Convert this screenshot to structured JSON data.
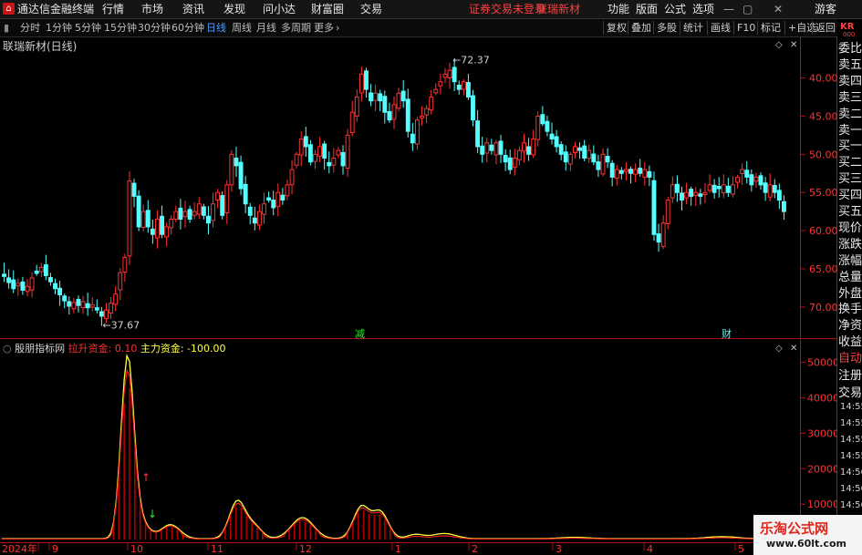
{
  "titlebar": {
    "app_name": "通达信金融终端",
    "menu": [
      "行情",
      "市场",
      "资讯",
      "发现",
      "问小达",
      "财富圈",
      "交易"
    ],
    "status_login": "证券交易未登录",
    "status_stock": "联瑞新材",
    "right_menu": [
      "功能",
      "版面",
      "公式",
      "选项"
    ],
    "guest": "游客"
  },
  "toolbar": {
    "periods": [
      "分时",
      "1分钟",
      "5分钟",
      "15分钟",
      "30分钟",
      "60分钟",
      "日线",
      "周线",
      "月线",
      "多周期",
      "更多"
    ],
    "active_period": "日线",
    "right_buttons": [
      "复权",
      "叠加",
      "多股",
      "统计",
      "画线",
      "F10",
      "标记",
      "+自选",
      "返回"
    ]
  },
  "main_chart": {
    "title": "联瑞新材(日线)",
    "y_ticks": [
      "70.00",
      "65.00",
      "60.00",
      "55.00",
      "50.00",
      "45.00",
      "40.00"
    ],
    "high_label": "72.37",
    "low_label": "37.67",
    "marker_jian": "减",
    "marker_cai": "财"
  },
  "indicator_panel": {
    "name": "殷朋指标网",
    "label1": "拉升资金:",
    "value1": "0.10",
    "label2": "主力资金:",
    "value2": "-100.00",
    "y_ticks": [
      "50000",
      "40000",
      "30000",
      "20000",
      "10000"
    ],
    "x_labels": [
      "2024年",
      "9",
      "10",
      "11",
      "12",
      "1",
      "2",
      "3",
      "4",
      "5"
    ]
  },
  "sidebar": {
    "items": [
      "委比",
      "卖五",
      "卖四",
      "卖三",
      "卖二",
      "卖一",
      "买一",
      "买二",
      "买三",
      "买四",
      "买五",
      "现价",
      "涨跌",
      "涨幅",
      "总量",
      "外盘",
      "换手",
      "净资",
      "收益"
    ],
    "code_prefix": "KR",
    "code_sub": "000",
    "auto": "自动",
    "register": "注册",
    "trade": "交易",
    "times": [
      "14:55",
      "14:55",
      "14:55",
      "14:55",
      "14:56",
      "14:56",
      "14:56",
      "14:56"
    ]
  },
  "watermark": {
    "name": "乐淘公式网",
    "url": "www.60lt.com"
  },
  "colors": {
    "up": "#ff3232",
    "down": "#54ffff",
    "axis": "#b01010",
    "active": "#4f9cff",
    "yellow_line": "#ffff40"
  },
  "chart_data": [
    {
      "type": "candlestick",
      "title": "联瑞新材(日线)",
      "ylim": [
        37,
        74
      ],
      "y_ticks": [
        40,
        45,
        50,
        55,
        60,
        65,
        70
      ],
      "annotations": [
        {
          "label": "72.37",
          "value": 72.37
        },
        {
          "label": "37.67",
          "value": 37.67
        }
      ],
      "closes": [
        44,
        43.2,
        42.4,
        43.1,
        42.2,
        42.7,
        43.8,
        44.4,
        45.2,
        44.1,
        43.3,
        42.4,
        41.6,
        40.8,
        40.1,
        40.6,
        40.2,
        40.7,
        39.9,
        40.3,
        39.6,
        38.8,
        39.6,
        40.5,
        41.7,
        44.5,
        46.5,
        56.5,
        54.5,
        50.5,
        52.5,
        50.5,
        49.5,
        51.5,
        49.5,
        50.5,
        51.5,
        52.5,
        51.5,
        52.5,
        51.5,
        52.5,
        53.5,
        52.0,
        51.0,
        53.5,
        55.0,
        52.0,
        56.0,
        60.0,
        58.5,
        55.5,
        53.5,
        52.0,
        51.0,
        52.5,
        53.5,
        54.0,
        53.0,
        55.0,
        54.0,
        56.0,
        58.0,
        60.0,
        62.0,
        61.0,
        59.0,
        60.0,
        61.0,
        59.5,
        58.5,
        59.5,
        60.5,
        58.5,
        62.5,
        65.5,
        67.5,
        70.5,
        68.5,
        67.0,
        68.0,
        67.0,
        65.5,
        64.5,
        66.5,
        68.0,
        67.0,
        63.0,
        61.5,
        64.5,
        65.0,
        66.0,
        67.5,
        68.5,
        69.5,
        70.5,
        71.0,
        69.5,
        68.5,
        69.5,
        67.5,
        64.5,
        61.0,
        60.0,
        61.5,
        60.5,
        61.5,
        60.0,
        59.0,
        58.0,
        59.5,
        60.5,
        61.5,
        60.0,
        62.0,
        65.0,
        64.0,
        63.0,
        62.0,
        61.0,
        60.0,
        59.0,
        60.0,
        61.0,
        60.5,
        59.5,
        60.5,
        59.0,
        58.0,
        60.0,
        59.0,
        57.0,
        58.0,
        57.5,
        58.0,
        57.5,
        58.0,
        57.5,
        58.0,
        57.0,
        49.5,
        48.5,
        51.0,
        54.0,
        56.0,
        55.0,
        54.0,
        55.0,
        54.5,
        55.0,
        54.5,
        55.0,
        56.0,
        55.0,
        55.5,
        56.0,
        55.0,
        56.0,
        57.0,
        58.0,
        57.0,
        56.0,
        57.0,
        56.0,
        55.0,
        56.0,
        55.0,
        54.0,
        52.5
      ]
    },
    {
      "type": "line",
      "name": "主力资金",
      "x_labels": [
        "2024年",
        "9",
        "10",
        "11",
        "12",
        "1",
        "2",
        "3",
        "4",
        "5"
      ],
      "ylim": [
        0,
        53000
      ],
      "y_ticks": [
        10000,
        20000,
        30000,
        40000,
        50000
      ],
      "peaks": [
        {
          "x_label": "10",
          "value": 51000
        },
        {
          "x_label": "11",
          "value": 10500
        },
        {
          "x_label": "12",
          "value": 6000
        },
        {
          "x_label": "12",
          "value": 9000
        }
      ],
      "markers": [
        {
          "type": "up-arrow"
        },
        {
          "type": "down-arrow"
        }
      ]
    }
  ]
}
